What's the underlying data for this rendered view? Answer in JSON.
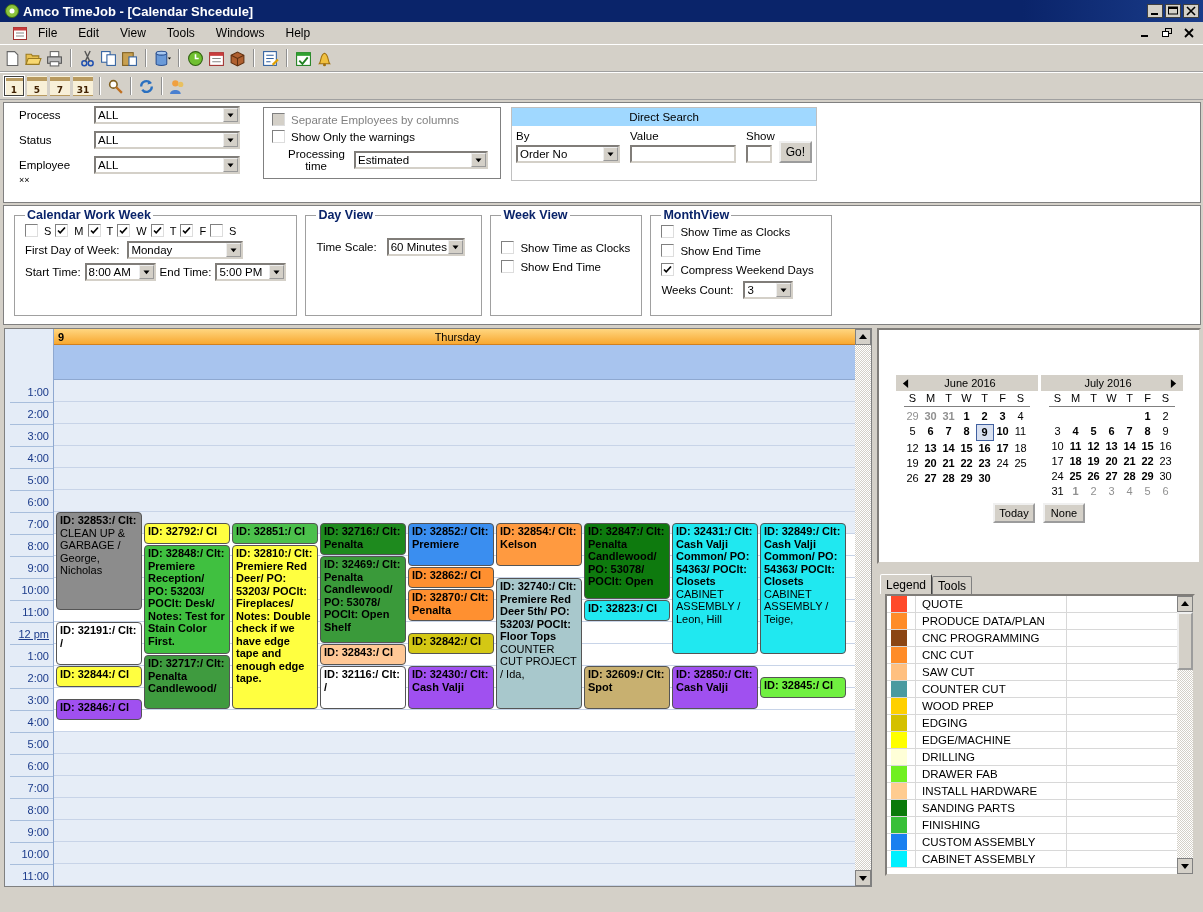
{
  "window": {
    "title": "Amco TimeJob - [Calendar Shcedule]"
  },
  "menu": [
    "File",
    "Edit",
    "View",
    "Tools",
    "Windows",
    "Help"
  ],
  "view_toolbar": [
    {
      "label": "1",
      "selected": true
    },
    {
      "label": "5",
      "selected": false
    },
    {
      "label": "7",
      "selected": false
    },
    {
      "label": "31",
      "selected": false
    }
  ],
  "filters": [
    {
      "label": "Process",
      "value": "ALL"
    },
    {
      "label": "Status",
      "value": "ALL"
    },
    {
      "label": "Employee",
      "value": "ALL"
    }
  ],
  "filters_note": "××",
  "options": {
    "separate_employees": {
      "label": "Separate Employees by columns",
      "checked": false,
      "disabled": true
    },
    "only_warnings": {
      "label": "Show Only the warnings",
      "checked": false,
      "disabled": false
    },
    "processing_label": "Processing time",
    "processing_value": "Estimated"
  },
  "direct_search": {
    "title": "Direct Search",
    "by_label": "By",
    "by_value": "Order No",
    "value_label": "Value",
    "show_label": "Show",
    "go_button": "Go!"
  },
  "work_week": {
    "title": "Calendar Work Week",
    "days": [
      {
        "label": "S",
        "checked": false
      },
      {
        "label": "M",
        "checked": true
      },
      {
        "label": "T",
        "checked": true
      },
      {
        "label": "W",
        "checked": true
      },
      {
        "label": "T",
        "checked": true
      },
      {
        "label": "F",
        "checked": true
      },
      {
        "label": "S",
        "checked": false
      }
    ],
    "first_day_label": "First Day of Week:",
    "first_day": "Monday",
    "start_label": "Start Time:",
    "start": "8:00 AM",
    "end_label": "End Time:",
    "end": "5:00 PM"
  },
  "day_view": {
    "title": "Day View",
    "scale_label": "Time Scale:",
    "scale": "60 Minutes"
  },
  "week_view": {
    "title": "Week View",
    "options": [
      {
        "label": "Show Time as Clocks",
        "checked": false
      },
      {
        "label": "Show End Time",
        "checked": false
      }
    ]
  },
  "month_view": {
    "title": "MonthView",
    "options": [
      {
        "label": "Show Time as Clocks",
        "checked": false
      },
      {
        "label": "Show End Time",
        "checked": false
      },
      {
        "label": "Compress Weekend Days",
        "checked": true
      }
    ],
    "weeks_label": "Weeks Count:",
    "weeks": "3"
  },
  "calendar": {
    "day_number": "9",
    "day_name": "Thursday",
    "times": [
      {
        "label": "1:00",
        "kind": "hour"
      },
      {
        "label": "2:00",
        "kind": "hour"
      },
      {
        "label": "3:00",
        "kind": "hour"
      },
      {
        "label": "4:00",
        "kind": "hour"
      },
      {
        "label": "5:00",
        "kind": "hour"
      },
      {
        "label": "6:00",
        "kind": "hour"
      },
      {
        "label": "7:00",
        "kind": "hour"
      },
      {
        "label": "8:00",
        "kind": "hour"
      },
      {
        "label": "9:00",
        "kind": "hour"
      },
      {
        "label": "10:00",
        "kind": "hour"
      },
      {
        "label": "11:00",
        "kind": "hour"
      },
      {
        "label": "12 pm",
        "kind": "noon"
      },
      {
        "label": "1:00",
        "kind": "hour"
      },
      {
        "label": "2:00",
        "kind": "hour"
      },
      {
        "label": "3:00",
        "kind": "hour"
      },
      {
        "label": "4:00",
        "kind": "hour"
      },
      {
        "label": "5:00",
        "kind": "hour"
      },
      {
        "label": "6:00",
        "kind": "hour"
      },
      {
        "label": "7:00",
        "kind": "hour"
      },
      {
        "label": "8:00",
        "kind": "hour"
      },
      {
        "label": "9:00",
        "kind": "hour"
      },
      {
        "label": "10:00",
        "kind": "hour"
      },
      {
        "label": "11:00",
        "kind": "hour"
      }
    ],
    "appointments": [
      {
        "title": "ID: 32853:/ Clt:",
        "detail": "CLEAN UP & GARBAGE / George, Nicholas",
        "color": "#8c8c8c"
      },
      {
        "title": "ID: 32191:/ Clt: /",
        "color": "#ffffff"
      },
      {
        "title": "ID: 32844:/ Cl",
        "color": "#ffff40"
      },
      {
        "title": "ID: 32846:/ Cl",
        "color": "#a050f0"
      },
      {
        "title": "ID: 32792:/ Cl",
        "color": "#ffff40"
      },
      {
        "title": "ID: 32848:/ Clt: Premiere Reception/ PO: 53203/ POClt: Desk/ Notes: Test for Stain Color First.",
        "color": "#40c040"
      },
      {
        "title": "ID: 32717:/ Clt: Penalta Candlewood/",
        "color": "#3f9b3f"
      },
      {
        "title": "ID: 32851:/ Cl",
        "color": "#4cc04c"
      },
      {
        "title": "ID: 32810:/ Clt: Premiere Red Deer/ PO: 53203/ POClt: Fireplaces/ Notes: Double check if we have edge tape and enough edge tape.",
        "color": "#ffff40"
      },
      {
        "title": "ID: 32716:/ Clt: Penalta",
        "color": "#1e8a1e"
      },
      {
        "title": "ID: 32469:/ Clt: Penalta Candlewood/ PO: 53078/ POClt: Open Shelf",
        "color": "#3a9a3a"
      },
      {
        "title": "ID: 32843:/ Cl",
        "color": "#ffc896"
      },
      {
        "title": "ID: 32116:/ Clt: /",
        "color": "#ffffff"
      },
      {
        "title": "ID: 32852:/ Clt: Premiere",
        "color": "#3a8ef0"
      },
      {
        "title": "ID: 32862:/ Cl",
        "color": "#ff9030"
      },
      {
        "title": "ID: 32870:/ Clt: Penalta",
        "color": "#ff9030"
      },
      {
        "title": "ID: 32842:/ Cl",
        "color": "#d4c814"
      },
      {
        "title": "ID: 32430:/ Clt: Cash Valji",
        "color": "#a050f0"
      },
      {
        "title": "ID: 32854:/ Clt: Kelson",
        "color": "#ff9a40"
      },
      {
        "title": "ID: 32740:/ Clt: Premiere Red Deer 5th/ PO: 53203/ POClt: Floor Tops",
        "detail": "COUNTER CUT PROJECT / Ida,",
        "color": "#a8c8cc"
      },
      {
        "title": "ID: 32847:/ Clt: Penalta Candlewood/ PO: 53078/ POClt: Open",
        "color": "#0e7a0e"
      },
      {
        "title": "ID: 32823:/ Cl",
        "color": "#20e8f0"
      },
      {
        "title": "ID: 32609:/ Clt: Spot",
        "color": "#c8b070"
      },
      {
        "title": "ID: 32431:/ Clt: Cash Valji Common/ PO: 54363/ POClt: Closets",
        "detail": "CABINET ASSEMBLY / Leon, Hill",
        "color": "#20e8f0"
      },
      {
        "title": "ID: 32850:/ Clt: Cash Valji",
        "color": "#a050f0"
      },
      {
        "title": "ID: 32849:/ Clt: Cash Valji Common/ PO: 54363/ POClt: Closets",
        "detail": "CABINET ASSEMBLY / Teige,",
        "color": "#20e8f0"
      },
      {
        "title": "ID: 32845:/ Cl",
        "color": "#70f040"
      }
    ]
  },
  "mini_calendar": {
    "months": [
      {
        "title": "June 2016",
        "weekdays": [
          "S",
          "M",
          "T",
          "W",
          "T",
          "F",
          "S"
        ],
        "weeks": [
          [
            {
              "t": "29",
              "bold": false,
              "dim": true,
              "selected": false
            },
            {
              "t": "30",
              "bold": true,
              "dim": true,
              "selected": false
            },
            {
              "t": "31",
              "bold": true,
              "dim": true,
              "selected": false
            },
            {
              "t": "1",
              "bold": true,
              "dim": false,
              "selected": false
            },
            {
              "t": "2",
              "bold": true,
              "dim": false,
              "selected": false
            },
            {
              "t": "3",
              "bold": true,
              "dim": false,
              "selected": false
            },
            {
              "t": "4",
              "bold": false,
              "dim": false,
              "selected": false
            }
          ],
          [
            {
              "t": "5",
              "bold": false,
              "dim": false,
              "selected": false
            },
            {
              "t": "6",
              "bold": true,
              "dim": false,
              "selected": false
            },
            {
              "t": "7",
              "bold": true,
              "dim": false,
              "selected": false
            },
            {
              "t": "8",
              "bold": true,
              "dim": false,
              "selected": false
            },
            {
              "t": "9",
              "bold": true,
              "dim": false,
              "selected": true
            },
            {
              "t": "10",
              "bold": true,
              "dim": false,
              "selected": false
            },
            {
              "t": "11",
              "bold": false,
              "dim": false,
              "selected": false
            }
          ],
          [
            {
              "t": "12",
              "bold": false,
              "dim": false,
              "selected": false
            },
            {
              "t": "13",
              "bold": true,
              "dim": false,
              "selected": false
            },
            {
              "t": "14",
              "bold": true,
              "dim": false,
              "selected": false
            },
            {
              "t": "15",
              "bold": true,
              "dim": false,
              "selected": false
            },
            {
              "t": "16",
              "bold": true,
              "dim": false,
              "selected": false
            },
            {
              "t": "17",
              "bold": true,
              "dim": false,
              "selected": false
            },
            {
              "t": "18",
              "bold": false,
              "dim": false,
              "selected": false
            }
          ],
          [
            {
              "t": "19",
              "bold": false,
              "dim": false,
              "selected": false
            },
            {
              "t": "20",
              "bold": true,
              "dim": false,
              "selected": false
            },
            {
              "t": "21",
              "bold": true,
              "dim": false,
              "selected": false
            },
            {
              "t": "22",
              "bold": true,
              "dim": false,
              "selected": false
            },
            {
              "t": "23",
              "bold": true,
              "dim": false,
              "selected": false
            },
            {
              "t": "24",
              "bold": false,
              "dim": false,
              "selected": false
            },
            {
              "t": "25",
              "bold": false,
              "dim": false,
              "selected": false
            }
          ],
          [
            {
              "t": "26",
              "bold": false,
              "dim": false,
              "selected": false
            },
            {
              "t": "27",
              "bold": true,
              "dim": false,
              "selected": false
            },
            {
              "t": "28",
              "bold": true,
              "dim": false,
              "selected": false
            },
            {
              "t": "29",
              "bold": true,
              "dim": false,
              "selected": false
            },
            {
              "t": "30",
              "bold": true,
              "dim": false,
              "selected": false
            }
          ]
        ]
      },
      {
        "title": "July 2016",
        "weekdays": [
          "S",
          "M",
          "T",
          "W",
          "T",
          "F",
          "S"
        ],
        "weeks": [
          [
            {
              "t": "1",
              "bold": true,
              "dim": false,
              "selected": false
            },
            {
              "t": "2",
              "bold": false,
              "dim": false,
              "selected": false
            }
          ],
          [
            {
              "t": "3",
              "bold": false,
              "dim": false,
              "selected": false
            },
            {
              "t": "4",
              "bold": true,
              "dim": false,
              "selected": false
            },
            {
              "t": "5",
              "bold": true,
              "dim": false,
              "selected": false
            },
            {
              "t": "6",
              "bold": true,
              "dim": false,
              "selected": false
            },
            {
              "t": "7",
              "bold": true,
              "dim": false,
              "selected": false
            },
            {
              "t": "8",
              "bold": true,
              "dim": false,
              "selected": false
            },
            {
              "t": "9",
              "bold": false,
              "dim": false,
              "selected": false
            }
          ],
          [
            {
              "t": "10",
              "bold": false,
              "dim": false,
              "selected": false
            },
            {
              "t": "11",
              "bold": true,
              "dim": false,
              "selected": false
            },
            {
              "t": "12",
              "bold": true,
              "dim": false,
              "selected": false
            },
            {
              "t": "13",
              "bold": true,
              "dim": false,
              "selected": false
            },
            {
              "t": "14",
              "bold": true,
              "dim": false,
              "selected": false
            },
            {
              "t": "15",
              "bold": true,
              "dim": false,
              "selected": false
            },
            {
              "t": "16",
              "bold": false,
              "dim": false,
              "selected": false
            }
          ],
          [
            {
              "t": "17",
              "bold": false,
              "dim": false,
              "selected": false
            },
            {
              "t": "18",
              "bold": true,
              "dim": false,
              "selected": false
            },
            {
              "t": "19",
              "bold": true,
              "dim": false,
              "selected": false
            },
            {
              "t": "20",
              "bold": true,
              "dim": false,
              "selected": false
            },
            {
              "t": "21",
              "bold": true,
              "dim": false,
              "selected": false
            },
            {
              "t": "22",
              "bold": true,
              "dim": false,
              "selected": false
            },
            {
              "t": "23",
              "bold": false,
              "dim": false,
              "selected": false
            }
          ],
          [
            {
              "t": "24",
              "bold": false,
              "dim": false,
              "selected": false
            },
            {
              "t": "25",
              "bold": true,
              "dim": false,
              "selected": false
            },
            {
              "t": "26",
              "bold": true,
              "dim": false,
              "selected": false
            },
            {
              "t": "27",
              "bold": true,
              "dim": false,
              "selected": false
            },
            {
              "t": "28",
              "bold": true,
              "dim": false,
              "selected": false
            },
            {
              "t": "29",
              "bold": true,
              "dim": false,
              "selected": false
            },
            {
              "t": "30",
              "bold": false,
              "dim": false,
              "selected": false
            }
          ],
          [
            {
              "t": "31",
              "bold": false,
              "dim": false,
              "selected": false
            },
            {
              "t": "1",
              "bold": true,
              "dim": true,
              "selected": false
            },
            {
              "t": "2",
              "bold": false,
              "dim": true,
              "selected": false
            },
            {
              "t": "3",
              "bold": false,
              "dim": true,
              "selected": false
            },
            {
              "t": "4",
              "bold": false,
              "dim": true,
              "selected": false
            },
            {
              "t": "5",
              "bold": false,
              "dim": true,
              "selected": false
            },
            {
              "t": "6",
              "bold": false,
              "dim": true,
              "selected": false
            }
          ]
        ]
      }
    ],
    "buttons": [
      "Today",
      "None"
    ]
  },
  "panel_tabs": [
    {
      "label": "Legend",
      "selected": true
    },
    {
      "label": "Tools",
      "selected": false
    }
  ],
  "legend": [
    {
      "label": "QUOTE",
      "color": "#ff4a2a"
    },
    {
      "label": "PRODUCE DATA/PLAN",
      "color": "#ff8c28"
    },
    {
      "label": "CNC PROGRAMMING",
      "color": "#8b4513"
    },
    {
      "label": "CNC CUT",
      "color": "#ff8c28"
    },
    {
      "label": "SAW CUT",
      "color": "#ffc080"
    },
    {
      "label": "COUNTER CUT",
      "color": "#4a9aa0"
    },
    {
      "label": "WOOD PREP",
      "color": "#ffd000"
    },
    {
      "label": "EDGING",
      "color": "#d4c000"
    },
    {
      "label": "EDGE/MACHINE",
      "color": "#ffff00"
    },
    {
      "label": "DRILLING",
      "color": "#ffffd8"
    },
    {
      "label": "DRAWER FAB",
      "color": "#70f020"
    },
    {
      "label": "INSTALL HARDWARE",
      "color": "#ffcc90"
    },
    {
      "label": "SANDING PARTS",
      "color": "#0a7a0a"
    },
    {
      "label": "FINISHING",
      "color": "#38c038"
    },
    {
      "label": "CUSTOM ASSEMBLY",
      "color": "#1a80f0"
    },
    {
      "label": "CABINET ASSEMBLY",
      "color": "#00f0ff"
    }
  ]
}
